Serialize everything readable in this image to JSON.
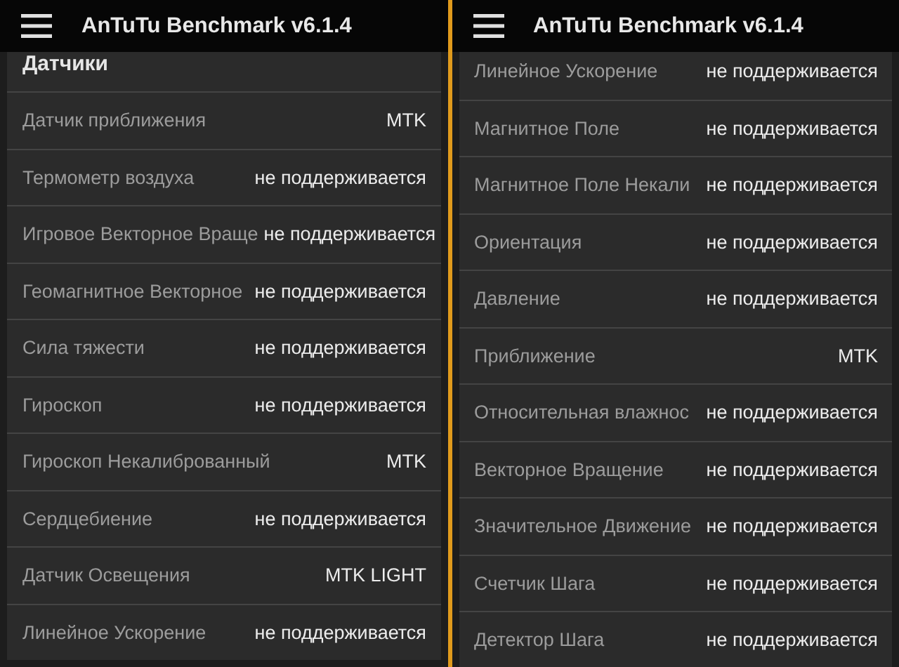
{
  "panels": [
    {
      "title": "AnTuTu Benchmark v6.1.4",
      "section_heading": "Датчики",
      "rows": [
        {
          "label": "Датчик приближения",
          "value": "MTK"
        },
        {
          "label": "Термометр воздуха",
          "value": "не поддерживается"
        },
        {
          "label": "Игровое Векторное Враще",
          "value": "не поддерживается"
        },
        {
          "label": "Геомагнитное Векторное",
          "value": "не поддерживается"
        },
        {
          "label": "Сила тяжести",
          "value": "не поддерживается"
        },
        {
          "label": "Гироскоп",
          "value": "не поддерживается"
        },
        {
          "label": "Гироскоп Некалиброванный",
          "value": "MTK"
        },
        {
          "label": "Сердцебиение",
          "value": "не поддерживается"
        },
        {
          "label": "Датчик Освещения",
          "value": "MTK LIGHT"
        },
        {
          "label": "Линейное Ускорение",
          "value": "не поддерживается"
        }
      ]
    },
    {
      "title": "AnTuTu Benchmark v6.1.4",
      "rows": [
        {
          "label": "Линейное Ускорение",
          "value": "не поддерживается"
        },
        {
          "label": "Магнитное Поле",
          "value": "не поддерживается"
        },
        {
          "label": "Магнитное Поле Некали",
          "value": "не поддерживается"
        },
        {
          "label": "Ориентация",
          "value": "не поддерживается"
        },
        {
          "label": "Давление",
          "value": "не поддерживается"
        },
        {
          "label": "Приближение",
          "value": "MTK"
        },
        {
          "label": "Относительная влажнос",
          "value": "не поддерживается"
        },
        {
          "label": "Векторное Вращение",
          "value": "не поддерживается"
        },
        {
          "label": "Значительное Движение",
          "value": "не поддерживается"
        },
        {
          "label": "Счетчик Шага",
          "value": "не поддерживается"
        },
        {
          "label": "Детектор Шага",
          "value": "не поддерживается"
        }
      ]
    }
  ]
}
